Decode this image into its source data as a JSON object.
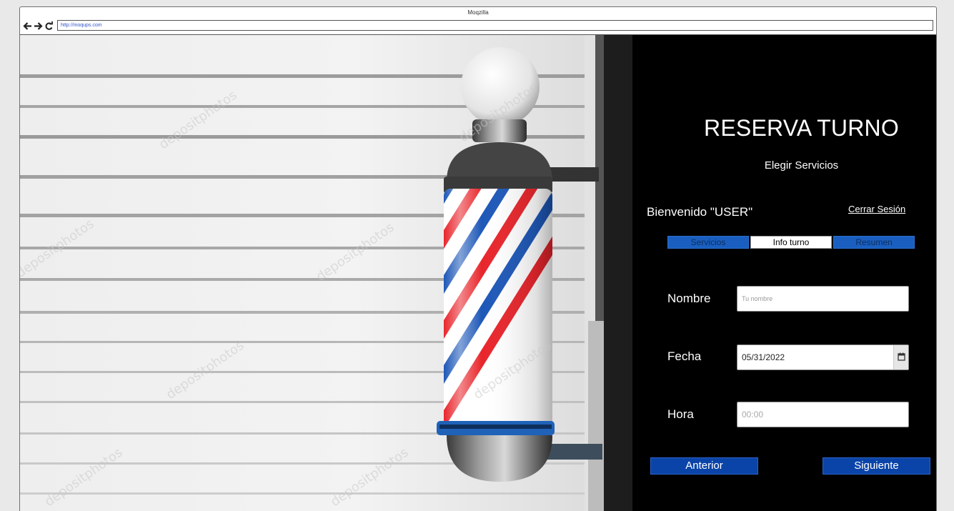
{
  "browser": {
    "title": "Moqzilla",
    "url": "http://moqups.com"
  },
  "hero": {
    "watermark": "depositphotos",
    "colors": {
      "red": "#e8262c",
      "blue": "#1e58b8"
    }
  },
  "panel": {
    "title": "RESERVA TURNO",
    "subtitle": "Elegir Servicios",
    "welcome": "Bienvenido \"USER\"",
    "logout": "Cerrar Sesión",
    "tabs": [
      {
        "label": "Servicios",
        "active": false
      },
      {
        "label": "Info turno",
        "active": true
      },
      {
        "label": "Resumen",
        "active": false
      }
    ],
    "form": {
      "name_label": "Nombre",
      "name_placeholder": "Tu nombre",
      "date_label": "Fecha",
      "date_value": "05/31/2022",
      "time_label": "Hora",
      "time_placeholder": "00:00"
    },
    "buttons": {
      "prev": "Anterior",
      "next": "Siguiente"
    },
    "colors": {
      "background": "#000000",
      "accent": "#0b44a8",
      "tab": "#1a5fbf"
    }
  }
}
